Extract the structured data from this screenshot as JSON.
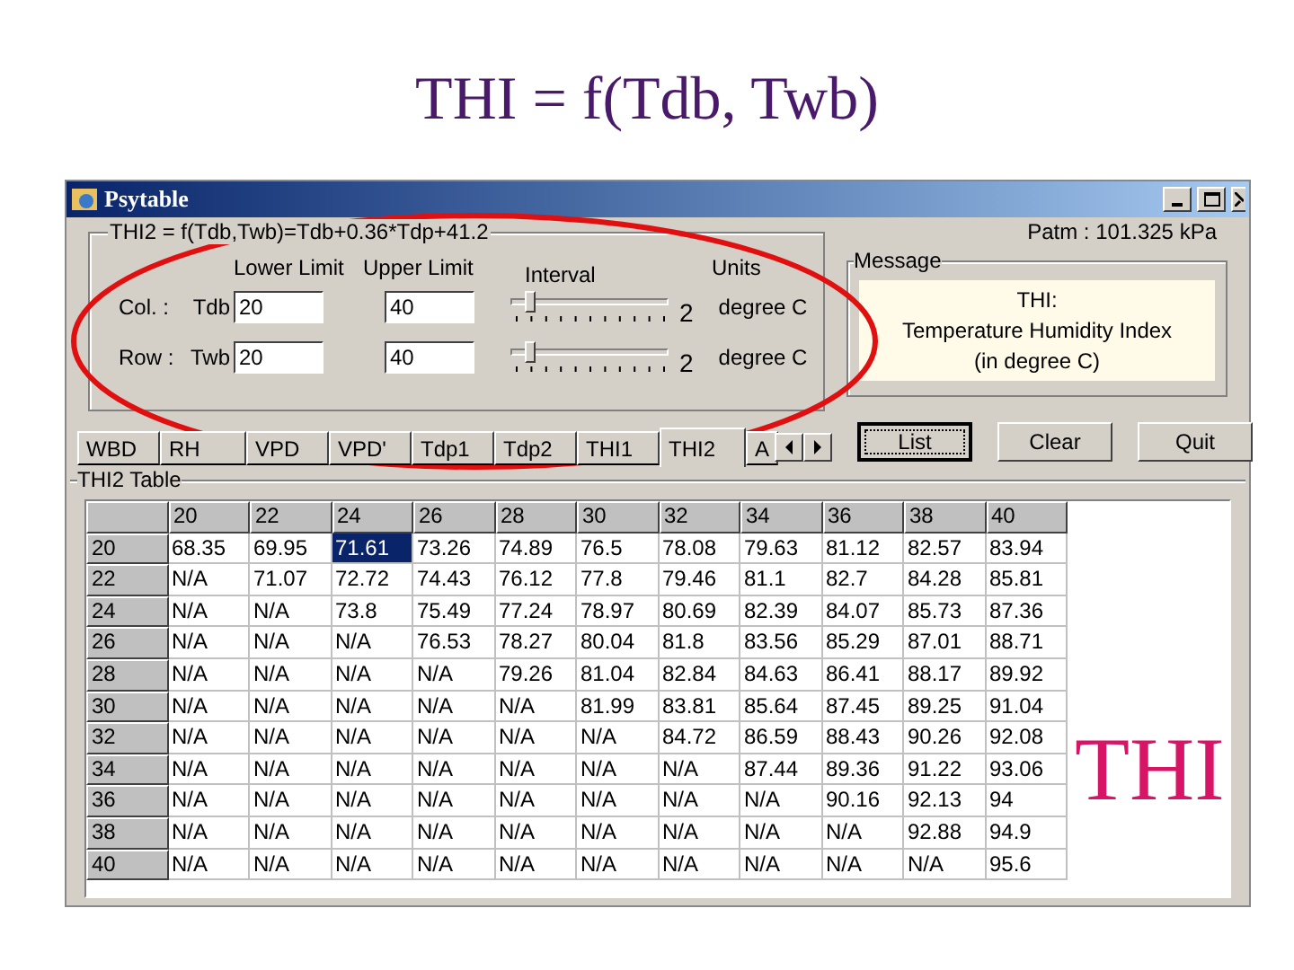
{
  "slide_title": "THI = f(Tdb, Twb)",
  "window": {
    "title": "Psytable"
  },
  "formula_group": {
    "title": "THI2 = f(Tdb,Twb)=Tdb+0.36*Tdp+41.2",
    "headers": [
      "Lower Limit",
      "Upper Limit",
      "Interval",
      "Units"
    ],
    "rows": [
      {
        "label": "Col. :",
        "variable": "Tdb",
        "lower": "20",
        "upper": "40",
        "level": 0.1,
        "interval": "2",
        "units": "degree C"
      },
      {
        "label": "Row :",
        "variable": "Twb",
        "lower": "20",
        "upper": "40",
        "level": 0.1,
        "interval": "2",
        "units": "degree C"
      }
    ]
  },
  "patm": "Patm : 101.325 kPa",
  "message": {
    "title": "Message",
    "lines": [
      "THI:",
      "Temperature Humidity Index",
      "(in degree C)"
    ]
  },
  "tabs": [
    {
      "label": "WBD",
      "selected": false
    },
    {
      "label": "RH",
      "selected": false
    },
    {
      "label": "VPD",
      "selected": false
    },
    {
      "label": "VPD'",
      "selected": false
    },
    {
      "label": "Tdp1",
      "selected": false
    },
    {
      "label": "Tdp2",
      "selected": false
    },
    {
      "label": "THI1",
      "selected": false
    },
    {
      "label": "THI2",
      "selected": true
    },
    {
      "label": "A",
      "selected": false
    }
  ],
  "buttons": [
    {
      "label": "List",
      "focused": true
    },
    {
      "label": "Clear",
      "focused": false
    },
    {
      "label": "Quit",
      "focused": false
    }
  ],
  "table": {
    "title": "THI2 Table",
    "columns": [
      "20",
      "22",
      "24",
      "26",
      "28",
      "30",
      "32",
      "34",
      "36",
      "38",
      "40"
    ],
    "rows": [
      {
        "header": "20",
        "cells": [
          {
            "text": "68.35",
            "selected": false
          },
          {
            "text": "69.95",
            "selected": false
          },
          {
            "text": "71.61",
            "selected": true
          },
          {
            "text": "73.26",
            "selected": false
          },
          {
            "text": "74.89",
            "selected": false
          },
          {
            "text": "76.5",
            "selected": false
          },
          {
            "text": "78.08",
            "selected": false
          },
          {
            "text": "79.63",
            "selected": false
          },
          {
            "text": "81.12",
            "selected": false
          },
          {
            "text": "82.57",
            "selected": false
          },
          {
            "text": "83.94",
            "selected": false
          }
        ]
      },
      {
        "header": "22",
        "cells": [
          {
            "text": "N/A",
            "selected": false
          },
          {
            "text": "71.07",
            "selected": false
          },
          {
            "text": "72.72",
            "selected": false
          },
          {
            "text": "74.43",
            "selected": false
          },
          {
            "text": "76.12",
            "selected": false
          },
          {
            "text": "77.8",
            "selected": false
          },
          {
            "text": "79.46",
            "selected": false
          },
          {
            "text": "81.1",
            "selected": false
          },
          {
            "text": "82.7",
            "selected": false
          },
          {
            "text": "84.28",
            "selected": false
          },
          {
            "text": "85.81",
            "selected": false
          }
        ]
      },
      {
        "header": "24",
        "cells": [
          {
            "text": "N/A",
            "selected": false
          },
          {
            "text": "N/A",
            "selected": false
          },
          {
            "text": "73.8",
            "selected": false
          },
          {
            "text": "75.49",
            "selected": false
          },
          {
            "text": "77.24",
            "selected": false
          },
          {
            "text": "78.97",
            "selected": false
          },
          {
            "text": "80.69",
            "selected": false
          },
          {
            "text": "82.39",
            "selected": false
          },
          {
            "text": "84.07",
            "selected": false
          },
          {
            "text": "85.73",
            "selected": false
          },
          {
            "text": "87.36",
            "selected": false
          }
        ]
      },
      {
        "header": "26",
        "cells": [
          {
            "text": "N/A",
            "selected": false
          },
          {
            "text": "N/A",
            "selected": false
          },
          {
            "text": "N/A",
            "selected": false
          },
          {
            "text": "76.53",
            "selected": false
          },
          {
            "text": "78.27",
            "selected": false
          },
          {
            "text": "80.04",
            "selected": false
          },
          {
            "text": "81.8",
            "selected": false
          },
          {
            "text": "83.56",
            "selected": false
          },
          {
            "text": "85.29",
            "selected": false
          },
          {
            "text": "87.01",
            "selected": false
          },
          {
            "text": "88.71",
            "selected": false
          }
        ]
      },
      {
        "header": "28",
        "cells": [
          {
            "text": "N/A",
            "selected": false
          },
          {
            "text": "N/A",
            "selected": false
          },
          {
            "text": "N/A",
            "selected": false
          },
          {
            "text": "N/A",
            "selected": false
          },
          {
            "text": "79.26",
            "selected": false
          },
          {
            "text": "81.04",
            "selected": false
          },
          {
            "text": "82.84",
            "selected": false
          },
          {
            "text": "84.63",
            "selected": false
          },
          {
            "text": "86.41",
            "selected": false
          },
          {
            "text": "88.17",
            "selected": false
          },
          {
            "text": "89.92",
            "selected": false
          }
        ]
      },
      {
        "header": "30",
        "cells": [
          {
            "text": "N/A",
            "selected": false
          },
          {
            "text": "N/A",
            "selected": false
          },
          {
            "text": "N/A",
            "selected": false
          },
          {
            "text": "N/A",
            "selected": false
          },
          {
            "text": "N/A",
            "selected": false
          },
          {
            "text": "81.99",
            "selected": false
          },
          {
            "text": "83.81",
            "selected": false
          },
          {
            "text": "85.64",
            "selected": false
          },
          {
            "text": "87.45",
            "selected": false
          },
          {
            "text": "89.25",
            "selected": false
          },
          {
            "text": "91.04",
            "selected": false
          }
        ]
      },
      {
        "header": "32",
        "cells": [
          {
            "text": "N/A",
            "selected": false
          },
          {
            "text": "N/A",
            "selected": false
          },
          {
            "text": "N/A",
            "selected": false
          },
          {
            "text": "N/A",
            "selected": false
          },
          {
            "text": "N/A",
            "selected": false
          },
          {
            "text": "N/A",
            "selected": false
          },
          {
            "text": "84.72",
            "selected": false
          },
          {
            "text": "86.59",
            "selected": false
          },
          {
            "text": "88.43",
            "selected": false
          },
          {
            "text": "90.26",
            "selected": false
          },
          {
            "text": "92.08",
            "selected": false
          }
        ]
      },
      {
        "header": "34",
        "cells": [
          {
            "text": "N/A",
            "selected": false
          },
          {
            "text": "N/A",
            "selected": false
          },
          {
            "text": "N/A",
            "selected": false
          },
          {
            "text": "N/A",
            "selected": false
          },
          {
            "text": "N/A",
            "selected": false
          },
          {
            "text": "N/A",
            "selected": false
          },
          {
            "text": "N/A",
            "selected": false
          },
          {
            "text": "87.44",
            "selected": false
          },
          {
            "text": "89.36",
            "selected": false
          },
          {
            "text": "91.22",
            "selected": false
          },
          {
            "text": "93.06",
            "selected": false
          }
        ]
      },
      {
        "header": "36",
        "cells": [
          {
            "text": "N/A",
            "selected": false
          },
          {
            "text": "N/A",
            "selected": false
          },
          {
            "text": "N/A",
            "selected": false
          },
          {
            "text": "N/A",
            "selected": false
          },
          {
            "text": "N/A",
            "selected": false
          },
          {
            "text": "N/A",
            "selected": false
          },
          {
            "text": "N/A",
            "selected": false
          },
          {
            "text": "N/A",
            "selected": false
          },
          {
            "text": "90.16",
            "selected": false
          },
          {
            "text": "92.13",
            "selected": false
          },
          {
            "text": "94",
            "selected": false
          }
        ]
      },
      {
        "header": "38",
        "cells": [
          {
            "text": "N/A",
            "selected": false
          },
          {
            "text": "N/A",
            "selected": false
          },
          {
            "text": "N/A",
            "selected": false
          },
          {
            "text": "N/A",
            "selected": false
          },
          {
            "text": "N/A",
            "selected": false
          },
          {
            "text": "N/A",
            "selected": false
          },
          {
            "text": "N/A",
            "selected": false
          },
          {
            "text": "N/A",
            "selected": false
          },
          {
            "text": "N/A",
            "selected": false
          },
          {
            "text": "92.88",
            "selected": false
          },
          {
            "text": "94.9",
            "selected": false
          }
        ]
      },
      {
        "header": "40",
        "cells": [
          {
            "text": "N/A",
            "selected": false
          },
          {
            "text": "N/A",
            "selected": false
          },
          {
            "text": "N/A",
            "selected": false
          },
          {
            "text": "N/A",
            "selected": false
          },
          {
            "text": "N/A",
            "selected": false
          },
          {
            "text": "N/A",
            "selected": false
          },
          {
            "text": "N/A",
            "selected": false
          },
          {
            "text": "N/A",
            "selected": false
          },
          {
            "text": "N/A",
            "selected": false
          },
          {
            "text": "N/A",
            "selected": false
          },
          {
            "text": "95.6",
            "selected": false
          }
        ]
      }
    ]
  },
  "overlay_label": "THI"
}
